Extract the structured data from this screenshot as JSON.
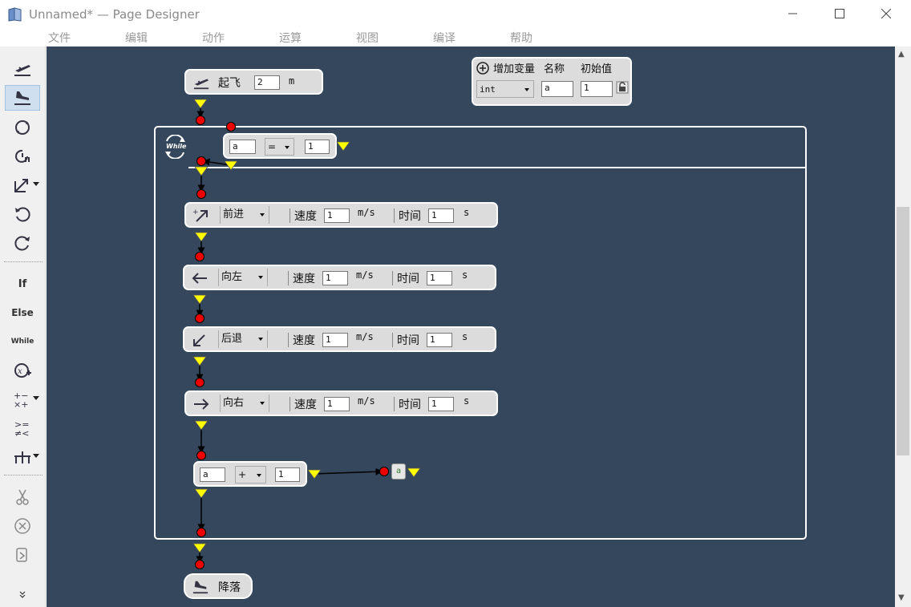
{
  "window": {
    "title": "Unnamed* — Page Designer"
  },
  "menu": [
    "文件",
    "编辑",
    "动作",
    "运算",
    "视图",
    "编译",
    "帮助"
  ],
  "toolbar": {
    "if_label": "If",
    "else_label": "Else",
    "while_label": "While"
  },
  "takeoff": {
    "label": "起飞",
    "value": "2",
    "unit": "m"
  },
  "land": {
    "label": "降落"
  },
  "variables": {
    "add_label": "增加变量",
    "name_header": "名称",
    "init_header": "初始值",
    "type": "int",
    "name": "a",
    "init": "1"
  },
  "loop": {
    "icon_text": "While",
    "left": "a",
    "op": "=",
    "right": "1"
  },
  "moves": [
    {
      "direction": "前进",
      "speed_label": "速度",
      "speed": "1",
      "speed_unit": "m/s",
      "time_label": "时间",
      "time": "1",
      "time_unit": "s"
    },
    {
      "direction": "向左",
      "speed_label": "速度",
      "speed": "1",
      "speed_unit": "m/s",
      "time_label": "时间",
      "time": "1",
      "time_unit": "s"
    },
    {
      "direction": "后退",
      "speed_label": "速度",
      "speed": "1",
      "speed_unit": "m/s",
      "time_label": "时间",
      "time": "1",
      "time_unit": "s"
    },
    {
      "direction": "向右",
      "speed_label": "速度",
      "speed": "1",
      "speed_unit": "m/s",
      "time_label": "时间",
      "time": "1",
      "time_unit": "s"
    }
  ],
  "math": {
    "left": "a",
    "op": "+",
    "right": "1",
    "result": "a"
  },
  "colors": {
    "canvas": "#35475c",
    "block": "#dcdcdc",
    "port_out": "#ffff00",
    "port_in": "#ff0000"
  }
}
